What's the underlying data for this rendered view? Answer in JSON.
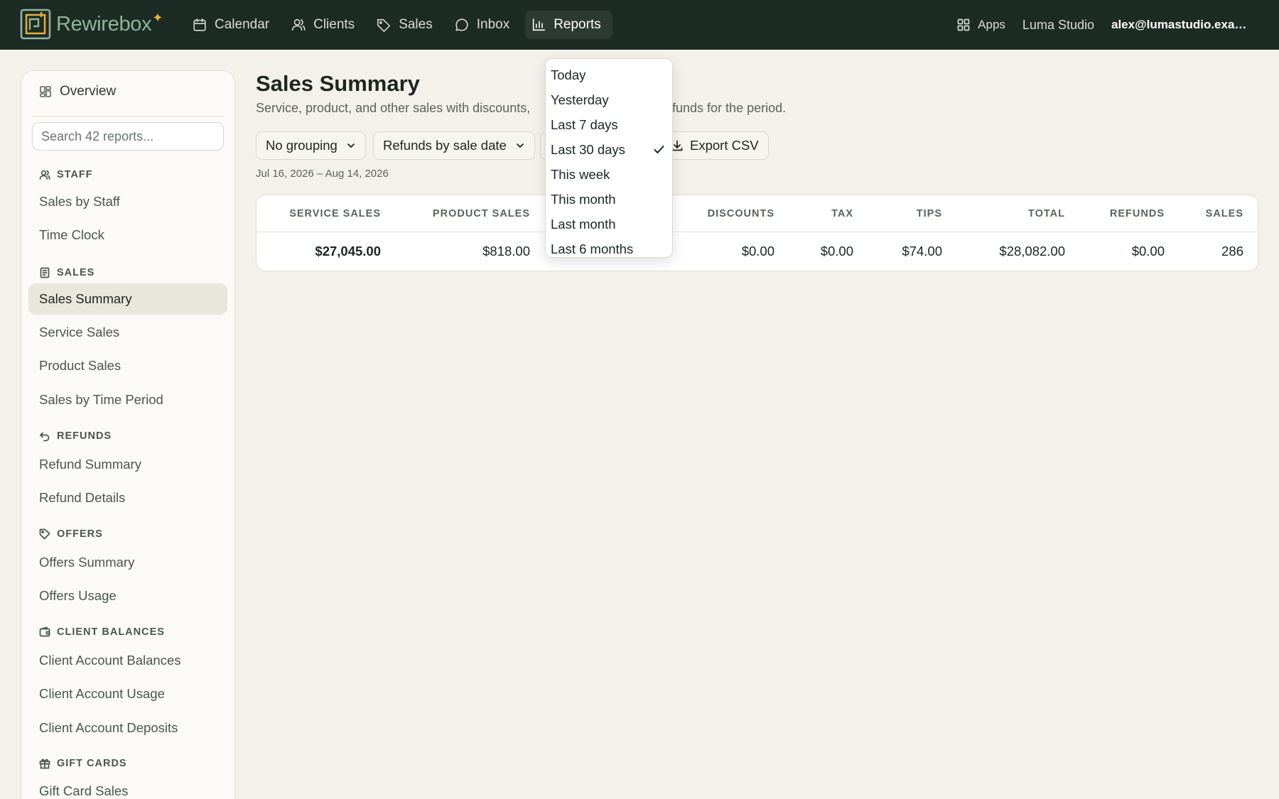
{
  "app": {
    "brand": "Rewirebox",
    "accent_color": "#8fb59a",
    "spark_color": "#e8b33a",
    "topbar_color": "#1d2b25"
  },
  "nav": [
    {
      "label": "Calendar",
      "icon": "calendar-icon"
    },
    {
      "label": "Clients",
      "icon": "users-icon"
    },
    {
      "label": "Sales",
      "icon": "tag-icon"
    },
    {
      "label": "Inbox",
      "icon": "chat-icon"
    },
    {
      "label": "Reports",
      "icon": "bar-chart-icon",
      "active": true
    }
  ],
  "topright": {
    "apps_label": "Apps",
    "studio": "Luma Studio",
    "email": "alex@lumastudio.exam..."
  },
  "sidebar": {
    "overview": "Overview",
    "search_placeholder": "Search 42 reports...",
    "sections": [
      {
        "title": "STAFF",
        "icon": "users-icon",
        "items": [
          "Sales by Staff",
          "Time Clock"
        ]
      },
      {
        "title": "SALES",
        "icon": "receipt-icon",
        "items": [
          "Sales Summary",
          "Service Sales",
          "Product Sales",
          "Sales by Time Period"
        ]
      },
      {
        "title": "REFUNDS",
        "icon": "undo-icon",
        "items": [
          "Refund Summary",
          "Refund Details"
        ]
      },
      {
        "title": "OFFERS",
        "icon": "tag-icon",
        "items": [
          "Offers Summary",
          "Offers Usage"
        ]
      },
      {
        "title": "CLIENT BALANCES",
        "icon": "wallet-icon",
        "items": [
          "Client Account Balances",
          "Client Account Usage",
          "Client Account Deposits"
        ]
      },
      {
        "title": "GIFT CARDS",
        "icon": "gift-icon",
        "items": [
          "Gift Card Sales"
        ]
      }
    ],
    "active_item": "Sales Summary"
  },
  "main": {
    "title": "Sales Summary",
    "subtitle": "Service, product, and other sales with discounts,",
    "subtitle_end": "efunds for the period.",
    "filters": {
      "grouping": "No grouping",
      "refunds": "Refunds by sale date",
      "export": "Export CSV"
    },
    "range": "Jul 16, 2026 – Aug 14, 2026",
    "table": {
      "headers": [
        "SERVICE SALES",
        "PRODUCT SALES",
        "DISCOUNTS",
        "TAX",
        "TIPS",
        "TOTAL",
        "REFUNDS",
        "SALES"
      ],
      "row": [
        "$27,045.00",
        "$818.00",
        "$0.00",
        "$0.00",
        "$74.00",
        "$28,082.00",
        "$0.00",
        "286"
      ]
    }
  },
  "dropdown": {
    "options": [
      "Today",
      "Yesterday",
      "Last 7 days",
      "Last 30 days",
      "This week",
      "This month",
      "Last month",
      "Last 6 months"
    ],
    "selected": "Last 30 days"
  }
}
